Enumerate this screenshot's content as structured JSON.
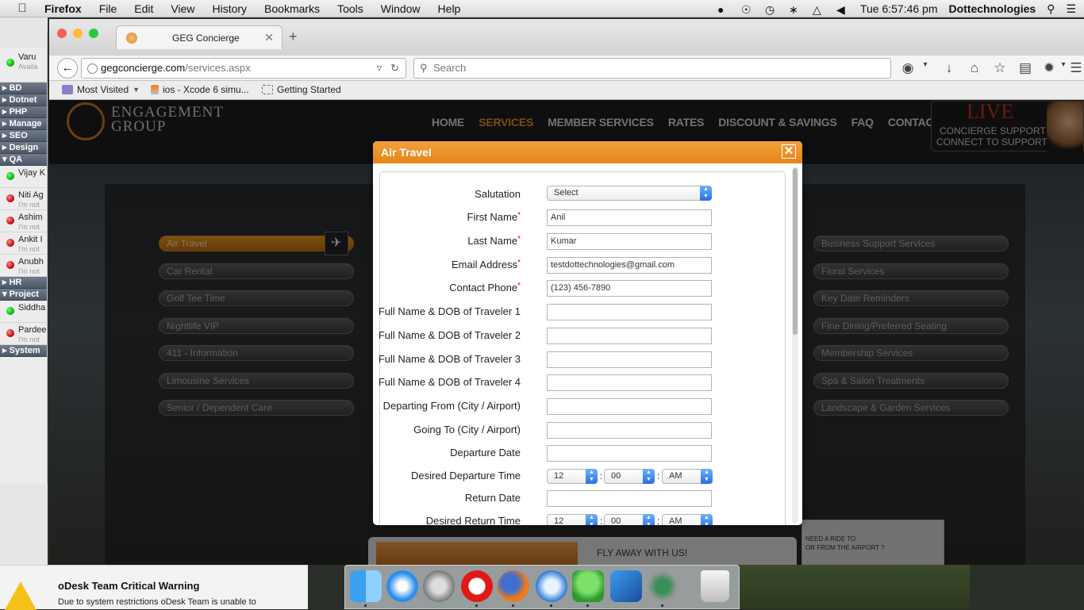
{
  "menubar": {
    "app": "Firefox",
    "items": [
      "File",
      "Edit",
      "View",
      "History",
      "Bookmarks",
      "Tools",
      "Window",
      "Help"
    ],
    "clock": "Tue 6:57:46 pm",
    "user": "Dottechnologies"
  },
  "side": {
    "top_contact": {
      "name": "Varu",
      "status": "Availa"
    },
    "groups_a": [
      "BD",
      "Dotnet",
      "PHP",
      "Manage",
      "SEO",
      "Design",
      "QA"
    ],
    "contacts_qa": [
      {
        "name": "Vijay K",
        "status": ""
      },
      {
        "name": "Niti Ag",
        "status": "I'm not"
      },
      {
        "name": "Ashim",
        "status": "I'm not"
      },
      {
        "name": "Ankit I",
        "status": "I'm not"
      },
      {
        "name": "Anubh",
        "status": "I'm not"
      }
    ],
    "groups_b": [
      "HR",
      "Project"
    ],
    "contacts_project": [
      {
        "name": "Siddha",
        "status": ""
      },
      {
        "name": "Pardee",
        "status": "I'm not"
      }
    ],
    "group_system": "System"
  },
  "browser": {
    "tab_title": "GEG Concierge",
    "new_tab": "+",
    "url_host": "gegconcierge.com",
    "url_path": "/services.aspx",
    "search_placeholder": "Search",
    "bookmarks": [
      "Most Visited",
      "ios - Xcode 6 simu...",
      "Getting Started"
    ]
  },
  "site": {
    "logo_line1": "ENGAGEMENT",
    "logo_line2": "GROUP",
    "nav": [
      "HOME",
      "SERVICES",
      "MEMBER SERVICES",
      "RATES",
      "DISCOUNT & SAVINGS",
      "FAQ",
      "CONTACT"
    ],
    "nav_active": "SERVICES",
    "live_big": "LIVE",
    "live_line1": "CONCIERGE SUPPORT",
    "live_line2": "CONNECT TO SUPPORT",
    "services_left": [
      "Air Travel",
      "Car Rental",
      "Golf Tee Time",
      "Nightlife VIP",
      "411 - Information",
      "Limousine Services",
      "Senior / Dependent Care"
    ],
    "services_right": [
      "Business Support Services",
      "Floral Services",
      "Key Date Reminders",
      "Fine Dining/Preferred Seating",
      "Membership Services",
      "Spa & Salon Treatments",
      "Landscape & Garden Services"
    ],
    "promo_text": "FLY AWAY WITH US!",
    "ride_line1": "NEED A RIDE TO",
    "ride_line2": "OR FROM THE AIRPORT ?"
  },
  "modal": {
    "title": "Air Travel",
    "close": "✕",
    "salutation_label": "Salutation",
    "salutation_value": "Select",
    "first_name_label": "First Name",
    "first_name_value": "Anil",
    "last_name_label": "Last Name",
    "last_name_value": "Kumar",
    "email_label": "Email Address",
    "email_value": "testdottechnologies@gmail.com",
    "phone_label": "Contact Phone",
    "phone_placeholder": "(123) 456-7890",
    "traveler1_label": "Full Name & DOB of Traveler 1",
    "traveler2_label": "Full Name & DOB of Traveler 2",
    "traveler3_label": "Full Name & DOB of Traveler 3",
    "traveler4_label": "Full Name & DOB of Traveler 4",
    "departing_label": "Departing From (City / Airport)",
    "going_label": "Going To (City / Airport)",
    "departure_date_label": "Departure Date",
    "departure_time_label": "Desired Departure Time",
    "dep_hour": "12",
    "dep_min": "00",
    "dep_ampm": "AM",
    "return_date_label": "Return Date",
    "return_time_label": "Desired Return Time",
    "ret_hour": "12",
    "ret_min": "00",
    "ret_ampm": "AM",
    "colon": ":"
  },
  "notification": {
    "title": "oDesk Team Critical Warning",
    "body": "Due to system restrictions oDesk Team is unable to"
  },
  "dock": {
    "apps": [
      "finder-icon",
      "safari-icon",
      "system-preferences-icon",
      "opera-icon",
      "firefox-icon",
      "mail-icon",
      "adium-icon",
      "xcode-icon",
      "network-utility-icon",
      "trash-icon"
    ]
  },
  "colors": {
    "accent": "#e3861a",
    "required": "#d0021b",
    "nav_active": "#e08a1e"
  }
}
